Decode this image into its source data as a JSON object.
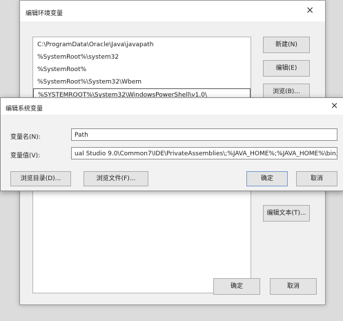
{
  "edit_env_dialog": {
    "title": "编辑环境变量",
    "close_glyph": "×",
    "path_items": [
      "C:\\ProgramData\\Oracle\\Java\\javapath",
      "%SystemRoot%\\system32",
      "%SystemRoot%",
      "%SystemRoot%\\System32\\Wbem",
      "%SYSTEMROOT%\\System32\\WindowsPowerShell\\v1.0\\"
    ],
    "buttons": {
      "new": "新建(N)",
      "edit": "编辑(E)",
      "browse": "浏览(B)...",
      "edit_text": "编辑文本(T)...",
      "ok": "确定",
      "cancel": "取消"
    }
  },
  "edit_sys_var_dialog": {
    "title": "编辑系统变量",
    "close_glyph": "×",
    "name_label": "变量名(N):",
    "name_value": "Path",
    "value_label": "变量值(V):",
    "value_value": "ual Studio 9.0\\Common7\\IDE\\PrivateAssemblies\\;%JAVA_HOME%;%JAVA_HOME%\\bin;",
    "buttons": {
      "browse_dir": "浏览目录(D)...",
      "browse_file": "浏览文件(F)...",
      "ok": "确定",
      "cancel": "取消"
    }
  }
}
